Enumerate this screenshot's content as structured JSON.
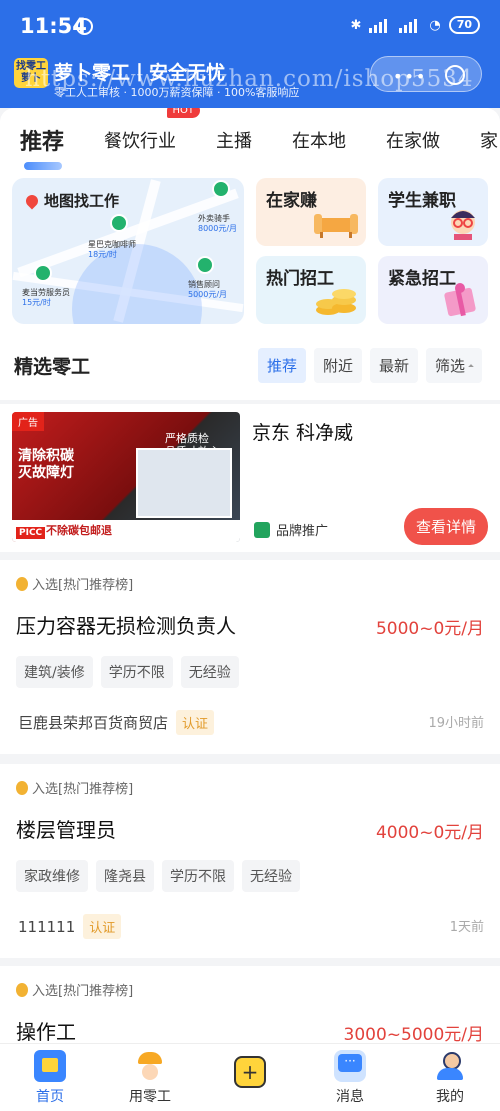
{
  "status": {
    "time": "11:54",
    "battery": "70",
    "hd1": "HD",
    "hd2": "HD"
  },
  "header": {
    "logo_line1": "找零工",
    "logo_line2": "萝卜",
    "title": "萝卜零工丨安全无忧",
    "subtitle": "零工人工审核 · 1000万薪资保障 · 100%客服响应",
    "watermark": "https://www.huzhan.com/ishop5534"
  },
  "tabs": [
    {
      "label": "推荐",
      "active": true
    },
    {
      "label": "餐饮行业",
      "badge": "HOT"
    },
    {
      "label": "主播"
    },
    {
      "label": "在本地"
    },
    {
      "label": "在家做"
    },
    {
      "label": "家"
    }
  ],
  "map_card": {
    "title": "地图找工作",
    "markers": [
      {
        "name": "外卖骑手",
        "pay": "8000元/月"
      },
      {
        "name": "星巴克咖啡师",
        "pay": "18元/时"
      },
      {
        "name": "麦当劳服务员",
        "pay": "15元/时"
      },
      {
        "name": "销售顾问",
        "pay": "5000元/月"
      }
    ]
  },
  "quick_cards": [
    {
      "label": "在家赚"
    },
    {
      "label": "学生兼职"
    },
    {
      "label": "热门招工"
    },
    {
      "label": "紧急招工"
    }
  ],
  "section": {
    "title": "精选零工",
    "filters": [
      "推荐",
      "附近",
      "最新",
      "筛选"
    ]
  },
  "ad": {
    "tag": "广告",
    "headline1": "清除积碳",
    "headline2": "灭故障灯",
    "slogan": "不除碳包邮退",
    "picc": "PICC",
    "cert_title1": "严格质检",
    "cert_title2": "品质才放心",
    "title": "京东 科净威",
    "brand_label": "品牌推广",
    "button": "查看详情"
  },
  "jobs": [
    {
      "badge": "入选[热门推荐榜]",
      "title": "压力容器无损检测负责人",
      "salary": "5000~0元/月",
      "tags": [
        "建筑/装修",
        "学历不限",
        "无经验"
      ],
      "company": "巨鹿县荣邦百货商贸店",
      "verified": "认证",
      "time": "19小时前"
    },
    {
      "badge": "入选[热门推荐榜]",
      "title": "楼层管理员",
      "salary": "4000~0元/月",
      "tags": [
        "家政维修",
        "隆尧县",
        "学历不限",
        "无经验"
      ],
      "company": "111111",
      "verified": "认证",
      "time": "1天前"
    },
    {
      "badge": "入选[热门推荐榜]",
      "title": "操作工",
      "salary": "3000~5000元/月"
    }
  ],
  "nav": [
    {
      "label": "首页",
      "icon": "home-icon",
      "active": true
    },
    {
      "label": "用零工",
      "icon": "worker-icon"
    },
    {
      "label": "",
      "icon": "plus-icon"
    },
    {
      "label": "消息",
      "icon": "message-icon"
    },
    {
      "label": "我的",
      "icon": "profile-icon"
    }
  ],
  "colors": {
    "primary": "#2c6fe8",
    "accent_red": "#e2423c",
    "hot": "#ef3b3b"
  }
}
